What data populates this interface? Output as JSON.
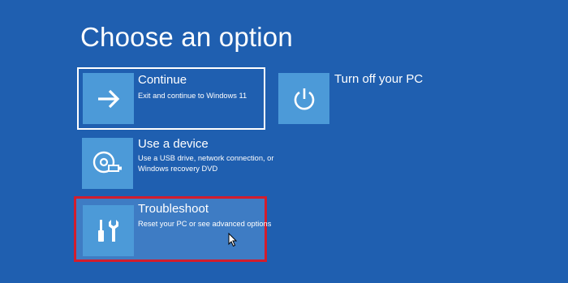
{
  "page": {
    "title": "Choose an option"
  },
  "options": {
    "continue": {
      "title": "Continue",
      "description": "Exit and continue to Windows 11",
      "icon": "arrow-right-icon"
    },
    "use_device": {
      "title": "Use a device",
      "description": "Use a USB drive, network connection, or Windows recovery DVD",
      "icon": "disc-drive-icon"
    },
    "troubleshoot": {
      "title": "Troubleshoot",
      "description": "Reset your PC or see advanced options",
      "icon": "tools-icon"
    },
    "turn_off": {
      "title": "Turn off your PC",
      "icon": "power-icon"
    }
  },
  "colors": {
    "background": "#1f5fb0",
    "tile": "#4c9ad8",
    "highlight_border": "#d21d2d",
    "focus_border": "#ffffff"
  }
}
